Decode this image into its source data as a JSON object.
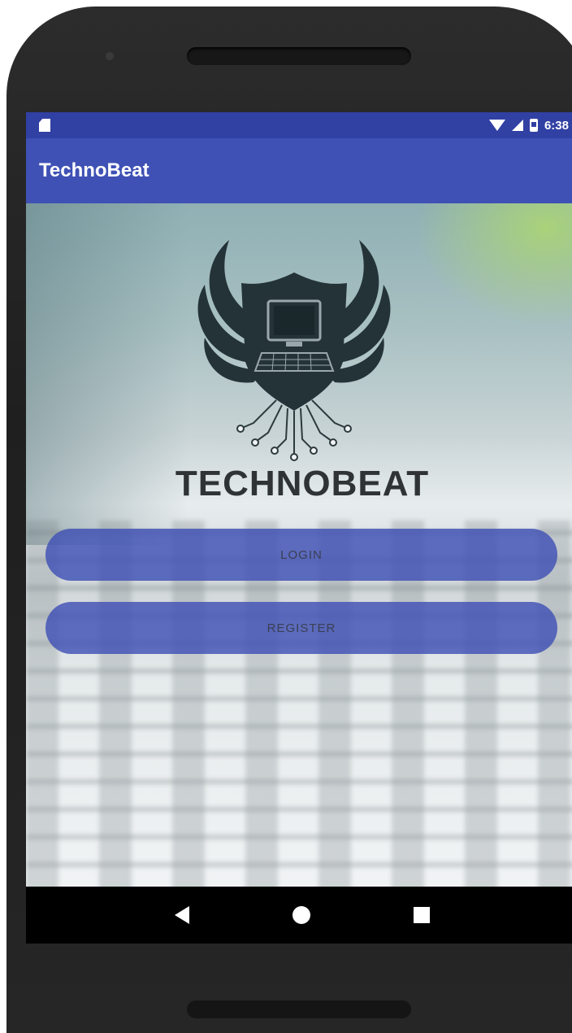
{
  "status_bar": {
    "time": "6:38"
  },
  "app_bar": {
    "title": "TechnoBeat"
  },
  "brand": {
    "name": "TECHNOBEAT"
  },
  "buttons": {
    "login": "LOGIN",
    "register": "REGISTER"
  },
  "icons": {
    "status": [
      "sd-card-icon",
      "wifi-icon",
      "signal-icon",
      "battery-icon"
    ],
    "nav": [
      "back-icon",
      "home-icon",
      "recents-icon"
    ],
    "logo": "winged-shield-computer-logo"
  },
  "colors": {
    "primary": "#3f51b5",
    "primary_dark": "#3140a3",
    "button": "#3f51b5",
    "brand_text": "#2f3336"
  }
}
